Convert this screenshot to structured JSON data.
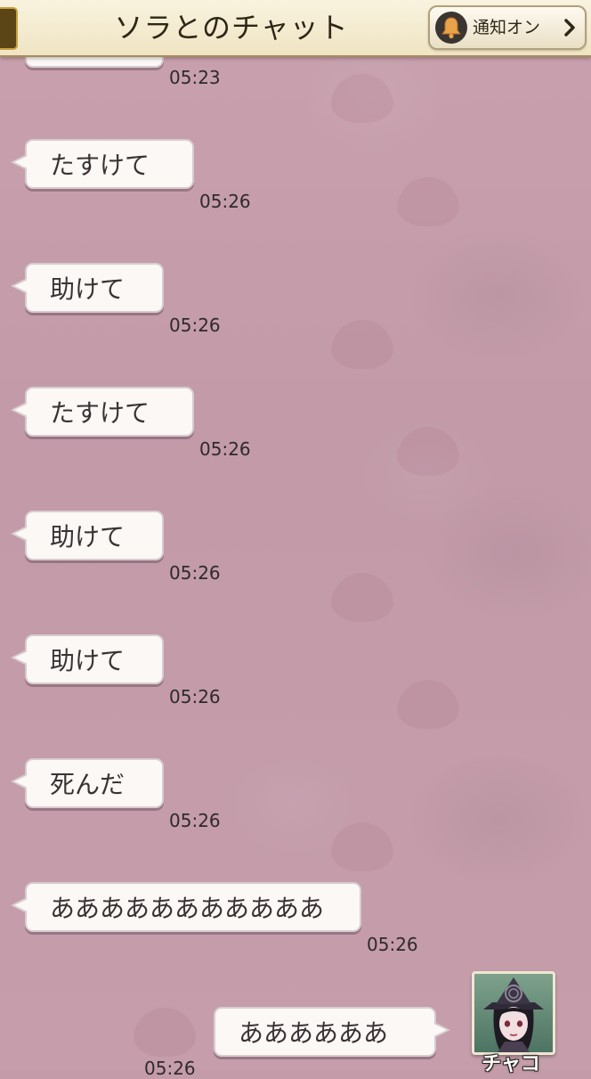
{
  "header": {
    "title": "ソラとのチャット",
    "notify_label": "通知オン",
    "back_icon": "back-tab",
    "bell_icon": "bell-icon",
    "chevron_icon": "chevron-right-icon"
  },
  "messages": [
    {
      "text": "",
      "time": "05:23",
      "side": "left"
    },
    {
      "text": "たすけて",
      "time": "05:26",
      "side": "left"
    },
    {
      "text": "助けて",
      "time": "05:26",
      "side": "left"
    },
    {
      "text": "たすけて",
      "time": "05:26",
      "side": "left"
    },
    {
      "text": "助けて",
      "time": "05:26",
      "side": "left"
    },
    {
      "text": "助けて",
      "time": "05:26",
      "side": "left"
    },
    {
      "text": "死んだ",
      "time": "05:26",
      "side": "left"
    },
    {
      "text": "あああああああああああ",
      "time": "05:26",
      "side": "left"
    },
    {
      "text": "ああああああ",
      "time": "05:26",
      "side": "right"
    }
  ],
  "sender": {
    "name": "チャコ",
    "avatar_icon": "witch-avatar-icon"
  },
  "colors": {
    "background": "#c49ca9",
    "header_bg": "#f4ebd2",
    "bubble_bg": "#fbf8f6",
    "text": "#3a3232"
  }
}
